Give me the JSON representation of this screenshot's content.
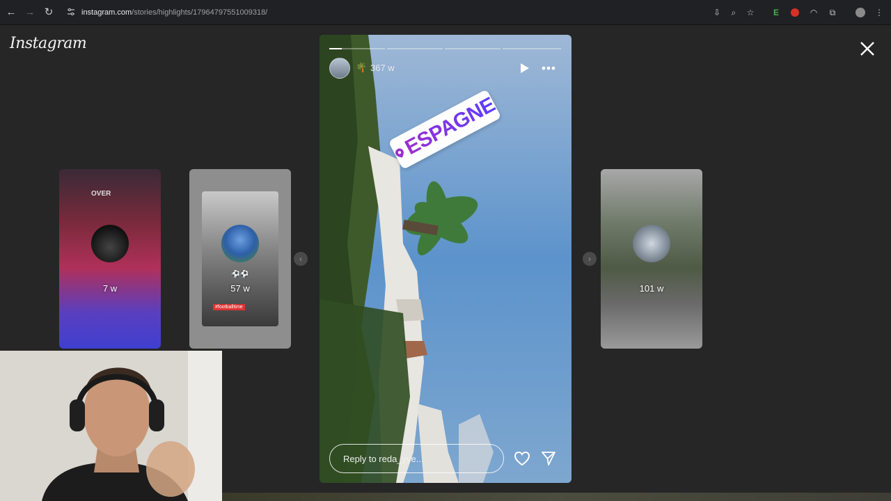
{
  "browser": {
    "url_host": "instagram.com",
    "url_path": "/stories/highlights/17964797551009318/",
    "extension_letter": "E"
  },
  "page": {
    "logo": "Instagram"
  },
  "highlights": [
    {
      "overlay_top": "OVER",
      "time": "7 w"
    },
    {
      "emoji": "⚽⚽",
      "time": "57 w",
      "tag": "#footballtime"
    },
    {
      "time": "101 w"
    }
  ],
  "story": {
    "emoji": "🌴",
    "time": "367 w",
    "sticker_text": "ESPAGNE",
    "progress_segments": 4,
    "progress_current": 0.22,
    "reply_placeholder": "Reply to reda_yye..."
  },
  "colors": {
    "page_bg": "#262626",
    "sticker_gradient": [
      "#9b2fd0",
      "#5c3dff"
    ]
  }
}
